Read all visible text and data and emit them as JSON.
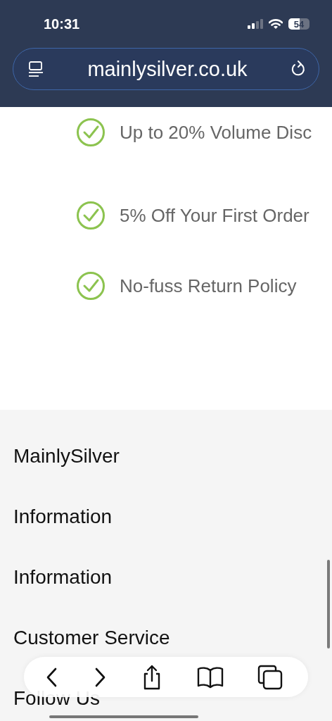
{
  "status_bar": {
    "time": "10:31",
    "battery": "54"
  },
  "address_bar": {
    "url": "mainlysilver.co.uk"
  },
  "features": [
    {
      "text": "Up to 20% Volume Disc"
    },
    {
      "text": "5% Off Your First Order"
    },
    {
      "text": "No-fuss Return Policy"
    }
  ],
  "footer_sections": [
    {
      "title": "MainlySilver"
    },
    {
      "title": "Information"
    },
    {
      "title": "Information"
    },
    {
      "title": "Customer Service"
    },
    {
      "title": "Follow Us"
    }
  ]
}
